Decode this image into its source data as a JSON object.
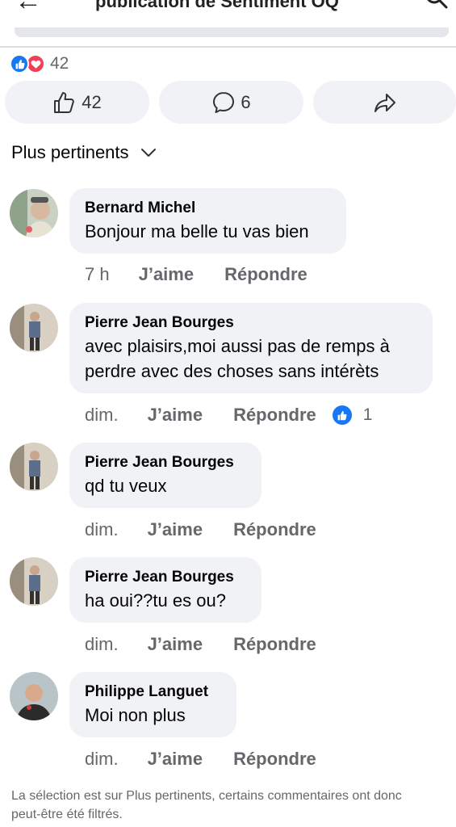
{
  "header": {
    "title": "publication de Sentiment OQ"
  },
  "reactions": {
    "count": "42",
    "types": [
      "like-icon",
      "love-icon"
    ]
  },
  "actions": {
    "like_count": "42",
    "comment_count": "6"
  },
  "sort": {
    "label": "Plus pertinents"
  },
  "comments": [
    {
      "author": "Bernard Michel",
      "text": "Bonjour ma belle tu vas bien",
      "time": "7 h",
      "like_label": "J’aime",
      "reply_label": "Répondre",
      "reaction_count": ""
    },
    {
      "author": "Pierre Jean Bourges",
      "text": "avec plaisirs,moi aussi pas de remps à perdre avec des choses sans intérèts",
      "time": "dim.",
      "like_label": "J’aime",
      "reply_label": "Répondre",
      "reaction_count": "1"
    },
    {
      "author": "Pierre Jean Bourges",
      "text": "qd tu veux",
      "time": "dim.",
      "like_label": "J’aime",
      "reply_label": "Répondre",
      "reaction_count": ""
    },
    {
      "author": "Pierre Jean Bourges",
      "text": "ha oui??tu es ou?",
      "time": "dim.",
      "like_label": "J’aime",
      "reply_label": "Répondre",
      "reaction_count": ""
    },
    {
      "author": "Philippe Languet",
      "text": "Moi non plus",
      "time": "dim.",
      "like_label": "J’aime",
      "reply_label": "Répondre",
      "reaction_count": ""
    }
  ],
  "footer": {
    "note": "La sélection est sur Plus pertinents, certains commentaires ont donc peut-être été filtrés."
  },
  "colors": {
    "accent": "#1877f2",
    "love": "#f33e58",
    "bubble": "#f0f2f5",
    "secondary_text": "#65676b"
  }
}
